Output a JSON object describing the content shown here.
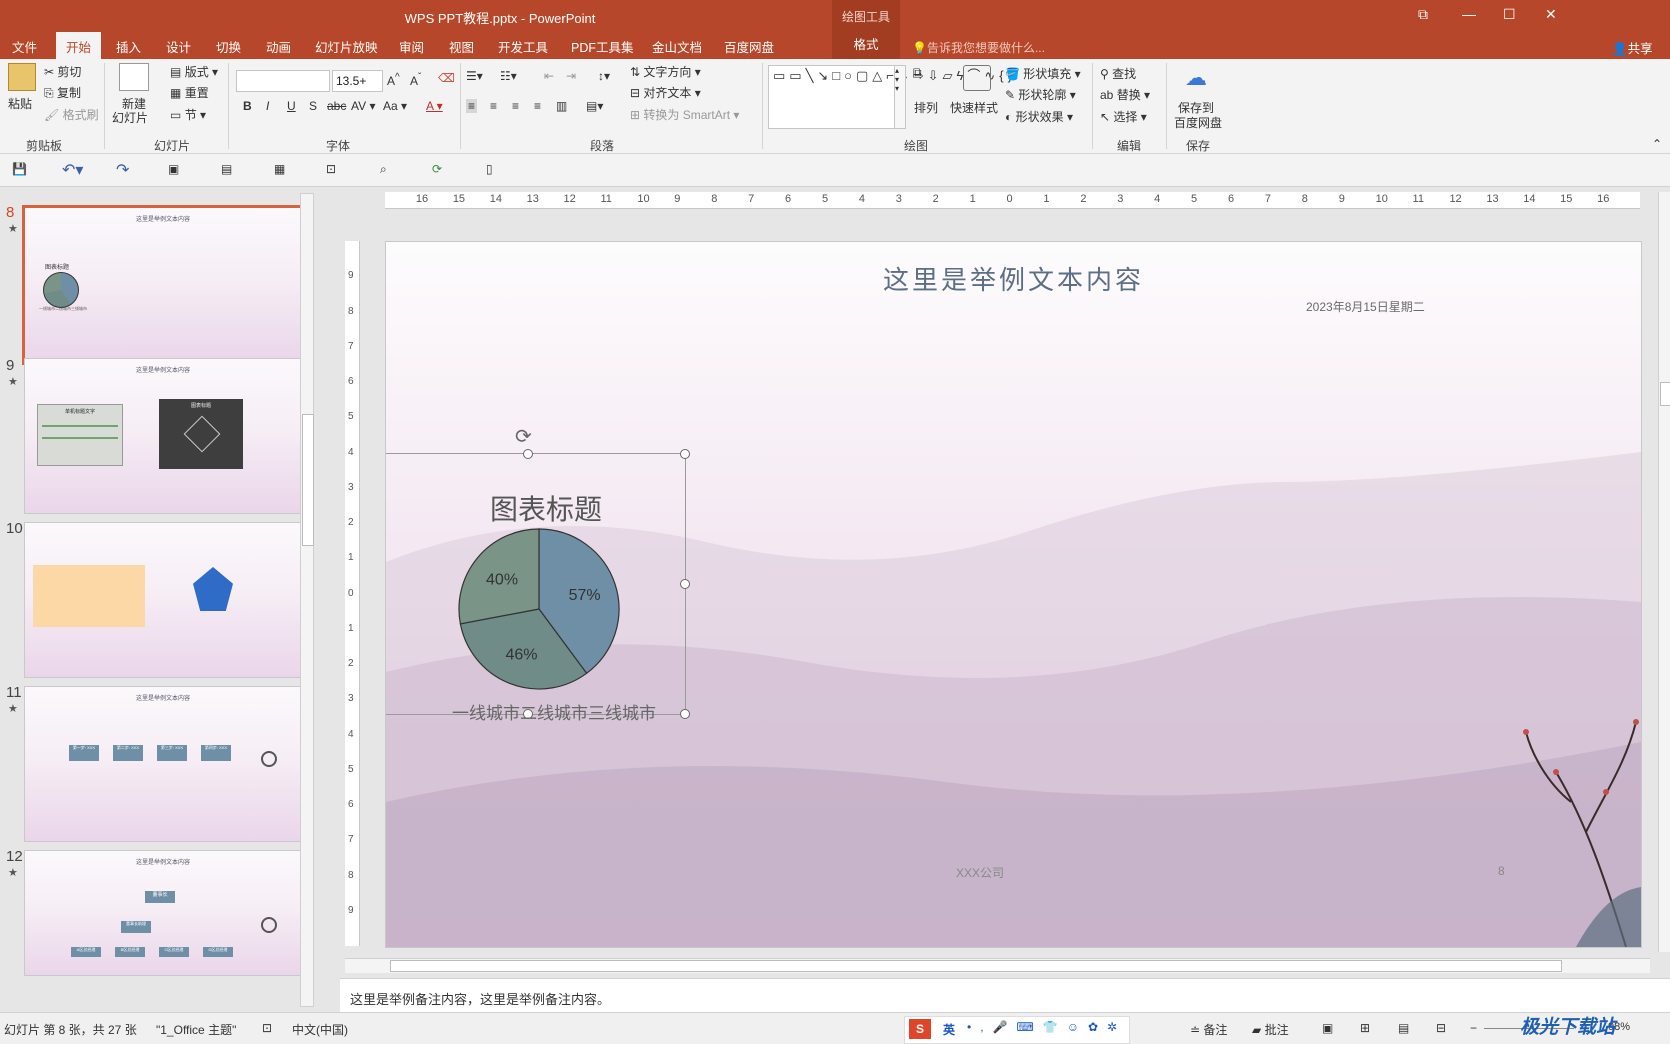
{
  "window": {
    "title": "WPS PPT教程.pptx - PowerPoint",
    "contextual_tab_group": "绘图工具"
  },
  "tabs": [
    "文件",
    "开始",
    "插入",
    "设计",
    "切换",
    "动画",
    "幻灯片放映",
    "审阅",
    "视图",
    "开发工具",
    "PDF工具集",
    "金山文档",
    "百度网盘"
  ],
  "active_tab": "开始",
  "format_tab": "格式",
  "tell_me_placeholder": "告诉我您想要做什么...",
  "share_label": "共享",
  "ribbon": {
    "clipboard": {
      "paste": "粘贴",
      "cut": "剪切",
      "copy": "复制",
      "format_painter": "格式刷",
      "group": "剪贴板"
    },
    "slides": {
      "new_slide": "新建",
      "new_slide2": "幻灯片",
      "layout": "版式",
      "reset": "重置",
      "section": "节",
      "group": "幻灯片"
    },
    "font": {
      "font_size": "13.5+",
      "group": "字体"
    },
    "paragraph": {
      "text_direction": "文字方向",
      "align_text": "对齐文本",
      "smartart": "转换为 SmartArt",
      "group": "段落"
    },
    "drawing": {
      "arrange": "排列",
      "quick_styles": "快速样式",
      "shape_fill": "形状填充",
      "shape_outline": "形状轮廓",
      "shape_effects": "形状效果",
      "group": "绘图"
    },
    "editing": {
      "find": "查找",
      "replace": "替换",
      "select": "选择",
      "group": "编辑"
    },
    "save": {
      "save1": "保存到",
      "save2": "百度网盘",
      "group": "保存"
    }
  },
  "ruler": {
    "h_labels": [
      "16",
      "15",
      "14",
      "13",
      "12",
      "11",
      "10",
      "9",
      "8",
      "7",
      "6",
      "5",
      "4",
      "3",
      "2",
      "1",
      "0",
      "1",
      "2",
      "3",
      "4",
      "5",
      "6",
      "7",
      "8",
      "9",
      "10",
      "11",
      "12",
      "13",
      "14",
      "15",
      "16"
    ],
    "v_labels": [
      "9",
      "8",
      "7",
      "6",
      "5",
      "4",
      "3",
      "2",
      "1",
      "0",
      "1",
      "2",
      "3",
      "4",
      "5",
      "6",
      "7",
      "8",
      "9"
    ]
  },
  "thumbnails": [
    {
      "number": "8",
      "star": "★",
      "title": "这里是举例文本内容",
      "selected": true
    },
    {
      "number": "9",
      "star": "★",
      "title": "这里是举例文本内容",
      "selected": false
    },
    {
      "number": "10",
      "star": "",
      "title": "",
      "selected": false
    },
    {
      "number": "11",
      "star": "★",
      "title": "这里是举例文本内容",
      "selected": false
    },
    {
      "number": "12",
      "star": "★",
      "title": "这里是举例文本内容",
      "selected": false
    }
  ],
  "thumb_texts": {
    "t9_chart_title": "单机标题文字",
    "t9_dark_title": "图表标题",
    "t11_steps": [
      "第一步: XXX",
      "第二步: XXX",
      "第三步: XXX",
      "第四步: XXX"
    ],
    "t12_top": "董事长",
    "t12_mid": "董事长助理",
    "t12_bottom": [
      "A区总经理",
      "B区总经理",
      "C区总经理",
      "D区总经理"
    ]
  },
  "slide": {
    "title": "这里是举例文本内容",
    "date": "2023年8月15日星期二",
    "footer": "XXX公司",
    "page_number": "8"
  },
  "chart_data": {
    "type": "pie",
    "title": "图表标题",
    "categories": [
      "一线城市",
      "二线城市",
      "三线城市"
    ],
    "values": [
      57,
      46,
      40
    ],
    "labels": [
      "57%",
      "46%",
      "40%"
    ],
    "colors": [
      "#6e8fa6",
      "#6f8c88",
      "#7a9588"
    ],
    "legend_text": "一线城市二线城市三线城市"
  },
  "notes": "这里是举例备注内容，这里是举例备注内容。",
  "status": {
    "slide_info": "幻灯片 第 8 张，共 27 张",
    "theme": "\"1_Office 主题\"",
    "language": "中文(中国)",
    "ime": "英",
    "notes_btn": "备注",
    "comments_btn": "批注",
    "zoom": "98%"
  },
  "watermark": "极光下载站"
}
